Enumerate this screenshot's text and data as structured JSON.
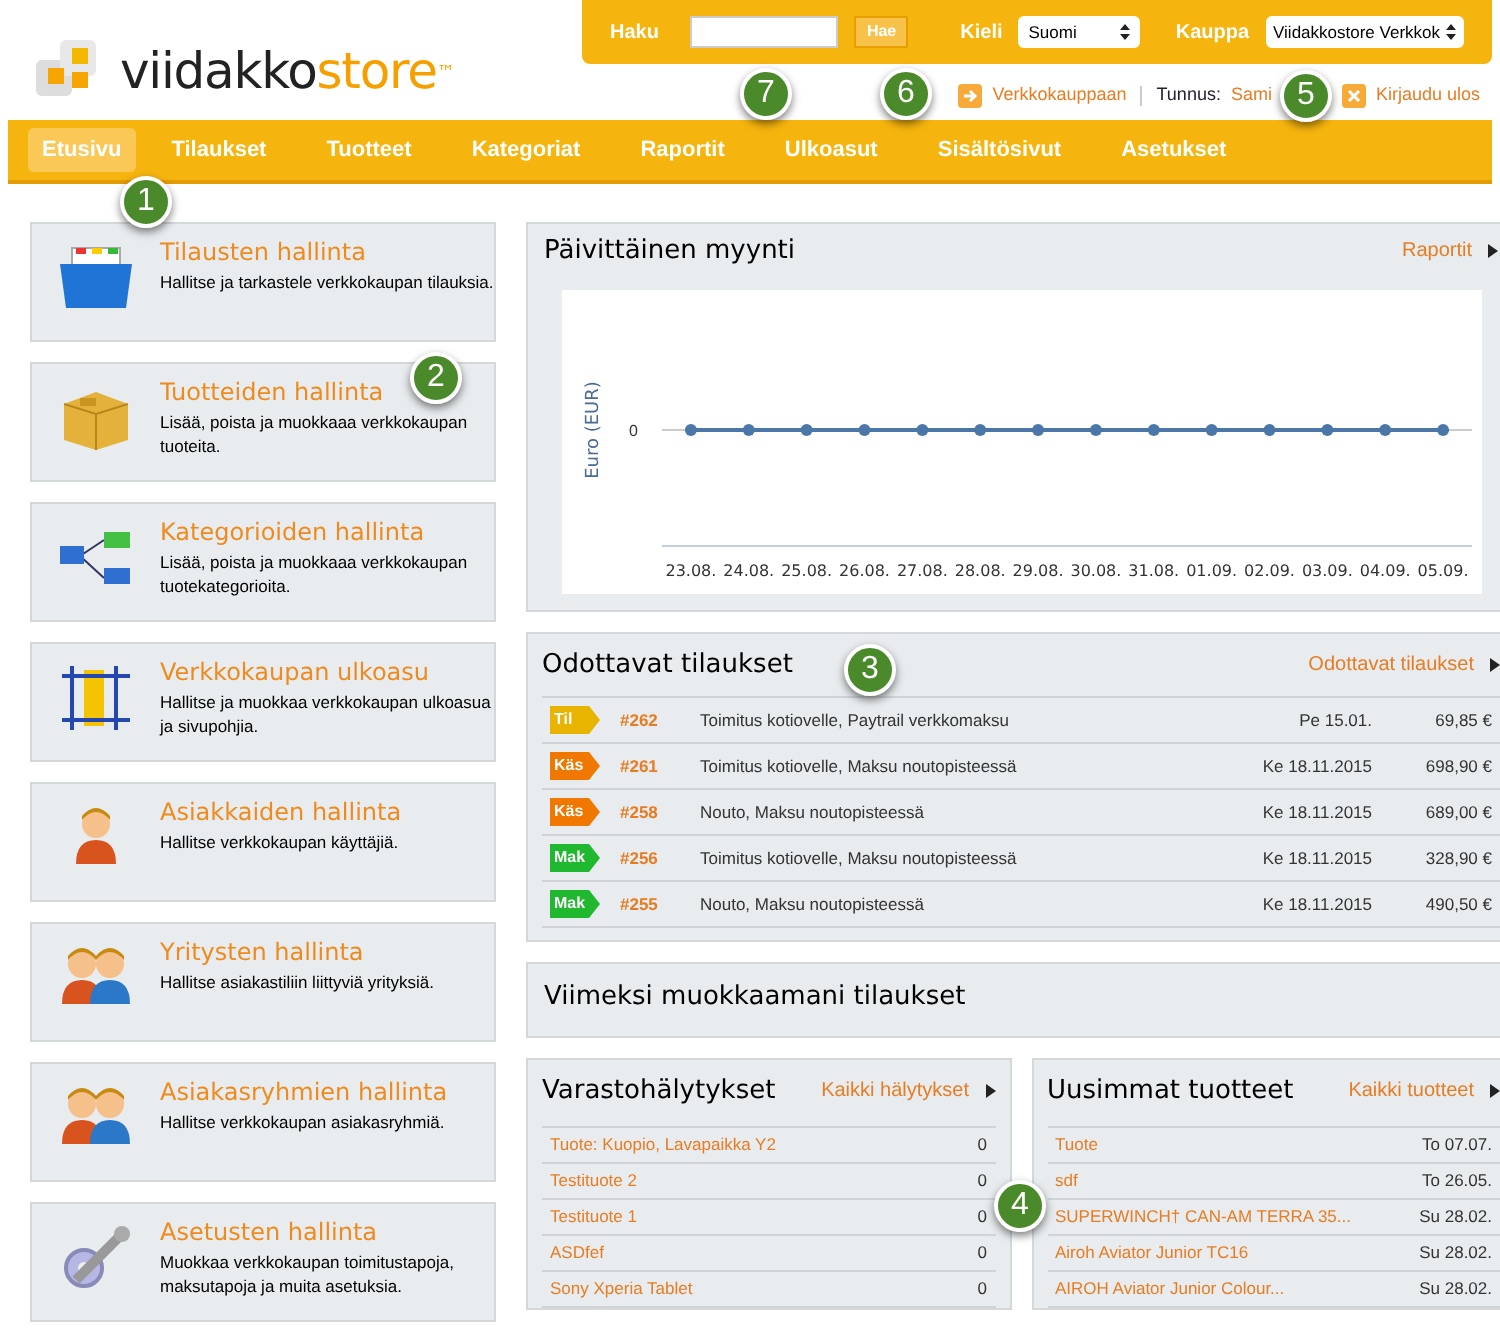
{
  "top_bar": {
    "search_label": "Haku",
    "search_button": "Hae",
    "language_label": "Kieli",
    "language": "Suomi",
    "store_label": "Kauppa",
    "store": "Viidakkostore Verkkok"
  },
  "logo": {
    "first": "viidakko",
    "second": "store",
    "mark": "™"
  },
  "user_links": {
    "shop_link": "Verkkokauppaan",
    "user_label": "Tunnus:",
    "user": "Sami",
    "logout": "Kirjaudu ulos"
  },
  "nav": [
    {
      "label": "Etusivu",
      "selected": true
    },
    {
      "label": "Tilaukset",
      "selected": false
    },
    {
      "label": "Tuotteet",
      "selected": false
    },
    {
      "label": "Kategoriat",
      "selected": false
    },
    {
      "label": "Raportit",
      "selected": false
    },
    {
      "label": "Ulkoasut",
      "selected": false
    },
    {
      "label": "Sisältösivut",
      "selected": false
    },
    {
      "label": "Asetukset",
      "selected": false
    }
  ],
  "shortcuts": [
    {
      "title": "Tilausten hallinta",
      "text": "Hallitse ja tarkastele verkkokaupan tilauksia."
    },
    {
      "title": "Tuotteiden hallinta",
      "text": "Lisää, poista ja muokkaaa verkkokaupan tuoteita."
    },
    {
      "title": "Kategorioiden hallinta",
      "text": "Lisää, poista ja muokkaaa verkkokaupan tuotekategorioita."
    },
    {
      "title": "Verkkokaupan ulkoasu",
      "text": "Hallitse ja muokkaa verkkokaupan ulkoasua ja sivupohjia."
    },
    {
      "title": "Asiakkaiden hallinta",
      "text": "Hallitse verkkokaupan käyttäjiä."
    },
    {
      "title": "Yritysten hallinta",
      "text": "Hallitse asiakastiliin liittyviä yrityksiä."
    },
    {
      "title": "Asiakasryhmien hallinta",
      "text": "Hallitse verkkokaupan asiakasryhmiä."
    },
    {
      "title": "Asetusten hallinta",
      "text": "Muokkaa verkkokaupan toimitustapoja, maksutapoja ja muita asetuksia."
    }
  ],
  "sales_panel": {
    "title": "Päivittäinen myynti",
    "link": "Raportit",
    "y_axis_title": "Euro (EUR)",
    "y_tick": "0",
    "dates": [
      "23.08.",
      "24.08.",
      "25.08.",
      "26.08.",
      "27.08.",
      "28.08.",
      "29.08.",
      "30.08.",
      "31.08.",
      "01.09.",
      "02.09.",
      "03.09.",
      "04.09.",
      "05.09."
    ]
  },
  "pending_orders": {
    "title": "Odottavat tilaukset",
    "link": "Odottavat tilaukset",
    "rows": [
      {
        "status": "Til",
        "color": "#e8b400",
        "number": "#262",
        "delivery": "Toimitus kotiovelle, Paytrail verkkomaksu",
        "date": "Pe 15.01.",
        "total": "69,85 €"
      },
      {
        "status": "Käs",
        "color": "#f07800",
        "number": "#261",
        "delivery": "Toimitus kotiovelle, Maksu noutopisteessä",
        "date": "Ke 18.11.2015",
        "total": "698,90 €"
      },
      {
        "status": "Käs",
        "color": "#f07800",
        "number": "#258",
        "delivery": "Nouto, Maksu noutopisteessä",
        "date": "Ke 18.11.2015",
        "total": "689,00 €"
      },
      {
        "status": "Mak",
        "color": "#1fb82e",
        "number": "#256",
        "delivery": "Toimitus kotiovelle, Maksu noutopisteessä",
        "date": "Ke 18.11.2015",
        "total": "328,90 €"
      },
      {
        "status": "Mak",
        "color": "#1fb82e",
        "number": "#255",
        "delivery": "Nouto, Maksu noutopisteessä",
        "date": "Ke 18.11.2015",
        "total": "490,50 €"
      }
    ]
  },
  "recent_orders": {
    "title": "Viimeksi muokkaamani tilaukset"
  },
  "stock_alerts": {
    "title": "Varastohälytykset",
    "link": "Kaikki hälytykset",
    "rows": [
      {
        "name": "Tuote: Kuopio, Lavapaikka Y2",
        "value": "0"
      },
      {
        "name": "Testituote 2",
        "value": "0"
      },
      {
        "name": "Testituote 1",
        "value": "0"
      },
      {
        "name": "ASDfef",
        "value": "0"
      },
      {
        "name": "Sony Xperia Tablet",
        "value": "0"
      }
    ]
  },
  "newest_products": {
    "title": "Uusimmat tuotteet",
    "link": "Kaikki tuotteet",
    "rows": [
      {
        "name": "Tuote",
        "value": "To 07.07."
      },
      {
        "name": "sdf",
        "value": "To 26.05."
      },
      {
        "name": "SUPERWINCH† CAN-AM TERRA 35...",
        "value": "Su 28.02."
      },
      {
        "name": "Airoh Aviator Junior TC16",
        "value": "Su 28.02."
      },
      {
        "name": "AIROH Aviator Junior Colour...",
        "value": "Su 28.02."
      }
    ]
  },
  "callouts": [
    "7",
    "6",
    "5",
    "1",
    "2",
    "3",
    "4"
  ]
}
